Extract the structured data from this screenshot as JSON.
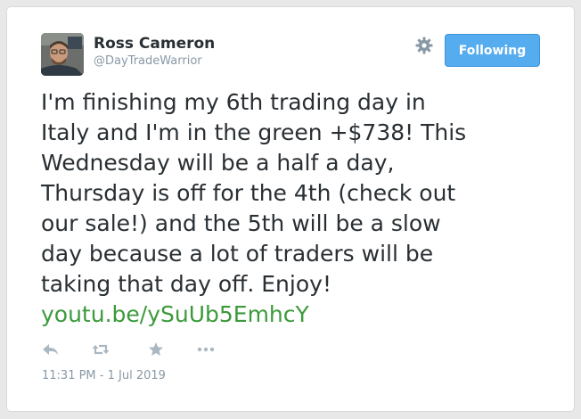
{
  "user": {
    "display_name": "Ross Cameron",
    "handle": "@DayTradeWarrior"
  },
  "follow_button": {
    "label": "Following"
  },
  "tweet": {
    "lines": [
      "I'm finishing my 6th trading day in",
      "Italy and I'm in the green +$738! This",
      "Wednesday will be a half a day,",
      "Thursday is off for the 4th (check out",
      "our sale!) and the 5th will be a slow",
      "day because a lot of traders will be",
      "taking that day off. Enjoy!"
    ],
    "link_text": "youtu.be/ySuUb5EmhcY",
    "timestamp": "11:31 PM - 1 Jul 2019"
  },
  "actions": [
    "reply-icon",
    "retweet-icon",
    "favorite-icon",
    "more-icon"
  ],
  "colors": {
    "follow_button": "#55acee",
    "link": "#3c9a3c",
    "text": "#292f33",
    "muted": "#8899a6",
    "action_icons": "#aab8c2"
  }
}
